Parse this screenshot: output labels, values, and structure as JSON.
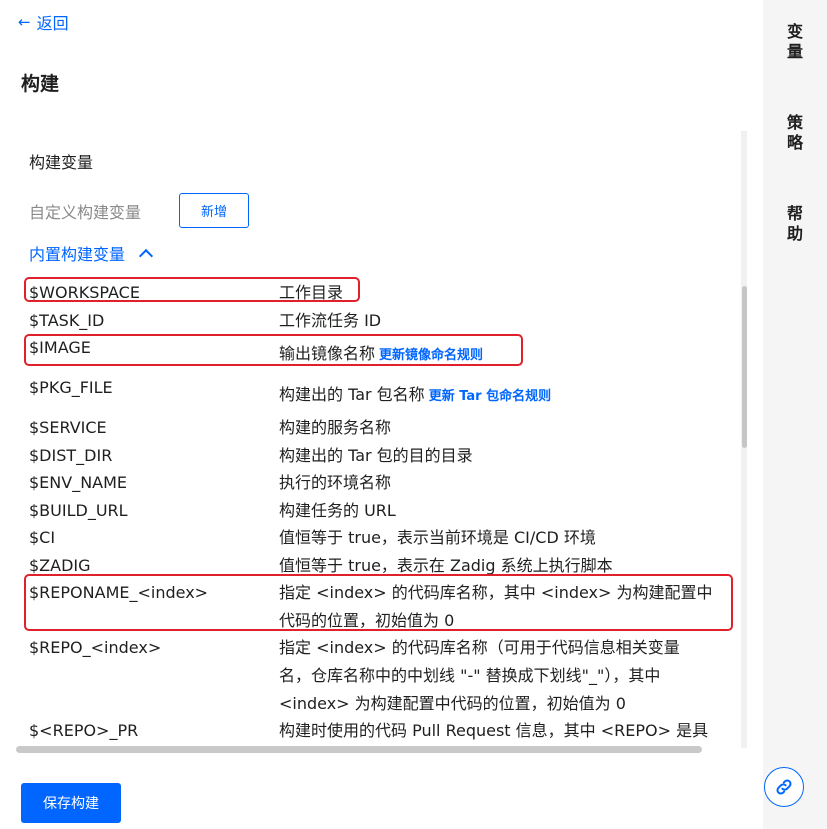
{
  "nav": {
    "back_label": "返回"
  },
  "page_title": "构建",
  "section": {
    "title": "构建变量",
    "custom_label": "自定义构建变量",
    "add_button": "新增",
    "builtin_label": "内置构建变量"
  },
  "vars": [
    {
      "name": "$WORKSPACE",
      "desc": "工作目录"
    },
    {
      "name": "$TASK_ID",
      "desc": "工作流任务 ID"
    },
    {
      "name": "$IMAGE",
      "desc": "输出镜像名称",
      "link": "更新镜像命名规则"
    },
    {
      "name": "$PKG_FILE",
      "desc": "构建出的 Tar 包名称",
      "link": "更新 Tar 包命名规则"
    },
    {
      "name": "$SERVICE",
      "desc": "构建的服务名称"
    },
    {
      "name": "$DIST_DIR",
      "desc": "构建出的 Tar 包的目的目录"
    },
    {
      "name": "$ENV_NAME",
      "desc": "执行的环境名称"
    },
    {
      "name": "$BUILD_URL",
      "desc": "构建任务的 URL"
    },
    {
      "name": "$CI",
      "desc": "值恒等于 true，表示当前环境是 CI/CD 环境"
    },
    {
      "name": "$ZADIG",
      "desc": "值恒等于 true，表示在 Zadig 系统上执行脚本"
    },
    {
      "name": "$REPONAME_<index>",
      "desc_lines": [
        "指定 <index> 的代码库名称，其中 <index> 为构建配置中",
        "代码的位置，初始值为 0"
      ]
    },
    {
      "name": "$REPO_<index>",
      "desc_lines": [
        "指定 <index> 的代码库名称（可用于代码信息相关变量",
        "名，仓库名称中的中划线 \"-\" 替换成下划线\"_\"），其中",
        "<index> 为构建配置中代码的位置，初始值为 0"
      ]
    },
    {
      "name": "$<REPO>_PR",
      "desc_lines": [
        "构建时使用的代码 Pull Request 信息，其中 <REPO> 是具"
      ]
    }
  ],
  "save_button": "保存构建",
  "side_tabs": [
    {
      "label": "变量",
      "chars": [
        "变",
        "量"
      ]
    },
    {
      "label": "策略",
      "chars": [
        "策",
        "略"
      ]
    },
    {
      "label": "帮助",
      "chars": [
        "帮",
        "助"
      ]
    }
  ],
  "colors": {
    "accent": "#0066ff",
    "highlight": "#e0202a",
    "sidebar_bg": "#f5f5f5"
  },
  "icons": {
    "back": "arrow-left-icon",
    "toggle": "chevron-up-icon",
    "share": "link-icon"
  }
}
